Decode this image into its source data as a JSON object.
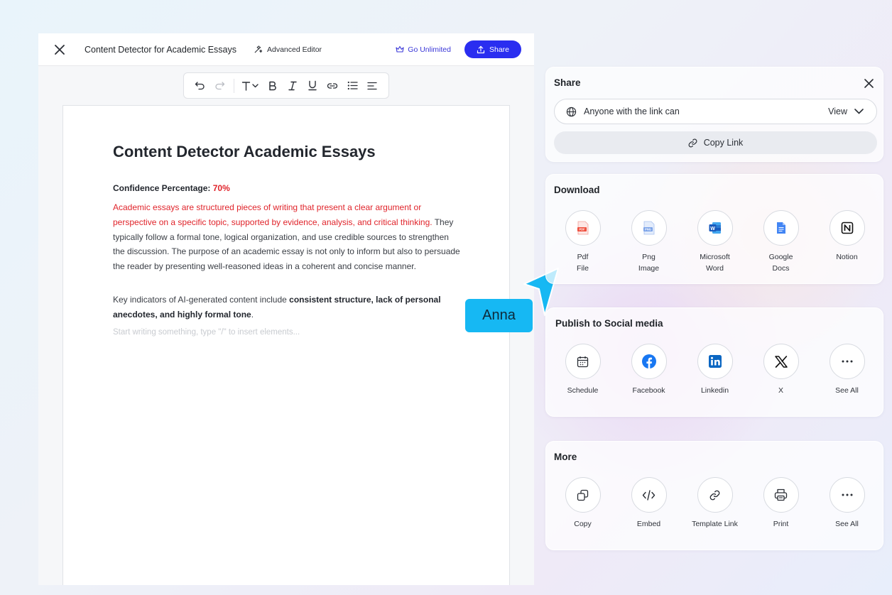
{
  "editor": {
    "doc_title": "Content Detector for Academic Essays",
    "advanced_editor": "Advanced Editor",
    "go_unlimited": "Go Unlimited",
    "share": "Share"
  },
  "document": {
    "heading": "Content Detector Academic Essays",
    "confidence_label": "Confidence Percentage:",
    "confidence_value": "70%",
    "para1_red": "Academic essays are structured pieces of writing that present a clear argument or perspective on a specific topic, supported by evidence, analysis, and critical thinking.",
    "para1_rest": "They typically follow a formal tone, logical organization, and use credible sources to strengthen the discussion. The purpose of an academic essay is not only to inform but also to persuade the reader by presenting well-reasoned ideas in a coherent and concise manner.",
    "para2_prefix": "Key indicators of AI-generated content include ",
    "para2_bold": "consistent structure, lack of personal anecdotes, and highly formal tone",
    "para2_suffix": ".",
    "placeholder": "Start writing something, type \"/\" to insert elements..."
  },
  "collaborator": {
    "name": "Anna",
    "color": "#16b8f3"
  },
  "share_panel": {
    "title": "Share",
    "access_label": "Anyone with the link can",
    "access_value": "View",
    "copy_link": "Copy Link"
  },
  "download_panel": {
    "title": "Download",
    "items": [
      {
        "line1": "Pdf",
        "line2": "File",
        "icon": "pdf-icon"
      },
      {
        "line1": "Png",
        "line2": "Image",
        "icon": "png-icon"
      },
      {
        "line1": "Microsoft",
        "line2": "Word",
        "icon": "word-icon"
      },
      {
        "line1": "Google",
        "line2": "Docs",
        "icon": "google-docs-icon"
      },
      {
        "line1": "Notion",
        "line2": "",
        "icon": "notion-icon"
      }
    ]
  },
  "social_panel": {
    "title": "Publish to Social media",
    "items": [
      {
        "label": "Schedule",
        "icon": "calendar-icon"
      },
      {
        "label": "Facebook",
        "icon": "facebook-icon"
      },
      {
        "label": "Linkedin",
        "icon": "linkedin-icon"
      },
      {
        "label": "X",
        "icon": "x-icon"
      },
      {
        "label": "See All",
        "icon": "more-icon"
      }
    ]
  },
  "more_panel": {
    "title": "More",
    "items": [
      {
        "label": "Copy",
        "icon": "copy-icon"
      },
      {
        "label": "Embed",
        "icon": "code-icon"
      },
      {
        "label": "Template Link",
        "icon": "link-icon"
      },
      {
        "label": "Print",
        "icon": "printer-icon"
      },
      {
        "label": "See All",
        "icon": "more-icon"
      }
    ]
  },
  "colors": {
    "accent": "#2a2ef0",
    "highlight": "#e0242b"
  }
}
